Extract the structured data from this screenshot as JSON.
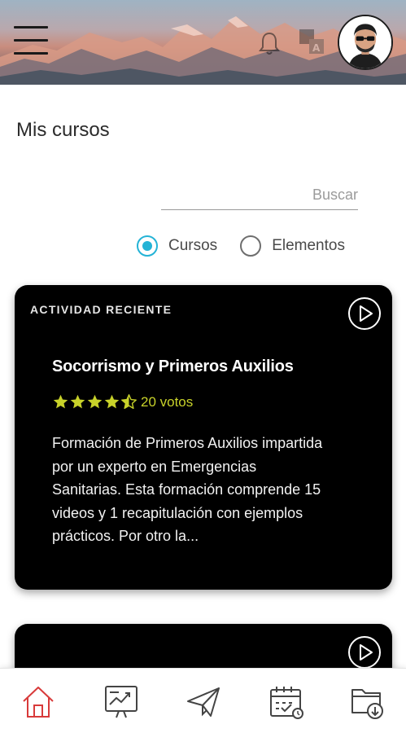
{
  "header": {
    "menu_icon": "hamburger-menu-icon",
    "bell_icon": "bell-icon",
    "translate_icon": "translate-icon",
    "avatar_icon": "user-avatar"
  },
  "page": {
    "title": "Mis cursos"
  },
  "search": {
    "placeholder": "Buscar",
    "value": ""
  },
  "filter": {
    "options": [
      {
        "label": "Cursos",
        "selected": true
      },
      {
        "label": "Elementos",
        "selected": false
      }
    ],
    "accent_color": "#24b3d6"
  },
  "cards": [
    {
      "kicker": "ACTIVIDAD RECIENTE",
      "title": "Socorrismo y Primeros Auxilios",
      "rating": 4.5,
      "votes_label": "20 votos",
      "description": "Formación de Primeros Auxilios impartida por un experto en Emergencias Sanitarias. Esta formación comprende 15 videos y 1 recapitulación con ejemplos prácticos. Por otro la...",
      "star_color": "#c8d22a"
    }
  ],
  "bottom_nav": [
    {
      "icon": "home-icon",
      "active": true,
      "color": "#d83a3a"
    },
    {
      "icon": "presentation-chart-icon",
      "active": false
    },
    {
      "icon": "send-paper-plane-icon",
      "active": false
    },
    {
      "icon": "calendar-check-icon",
      "active": false
    },
    {
      "icon": "folder-download-icon",
      "active": false
    }
  ]
}
